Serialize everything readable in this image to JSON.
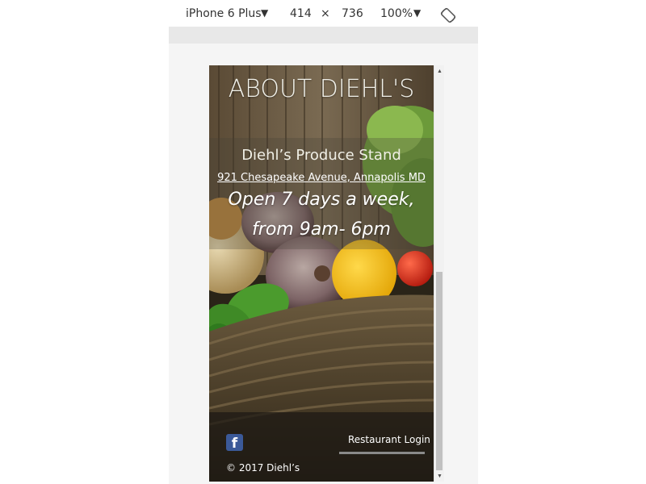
{
  "devtools": {
    "device": "iPhone 6 Plus",
    "device_caret": "▼",
    "width": "414",
    "times": "×",
    "height": "736",
    "zoom": "100%",
    "zoom_caret": "▼",
    "rotate_icon": "rotate-icon"
  },
  "page": {
    "title": "ABOUT DIEHL'S",
    "stand_name": "Diehl’s Produce Stand",
    "address": "921 Chesapeake Avenue, Annapolis MD",
    "hours_line1": "Open 7 days a week,",
    "hours_line2": "from 9am- 6pm",
    "facebook_icon": "facebook-icon",
    "facebook_letter": "f",
    "login_label": "Restaurant Login",
    "copyright": "© 2017 Diehl’s"
  },
  "scrollbar": {
    "up_arrow": "▲",
    "down_arrow": "▼"
  },
  "colors": {
    "facebook_blue": "#3b5998",
    "text_light": "#f1f1ea",
    "scroll_thumb": "#c1c1c1"
  }
}
